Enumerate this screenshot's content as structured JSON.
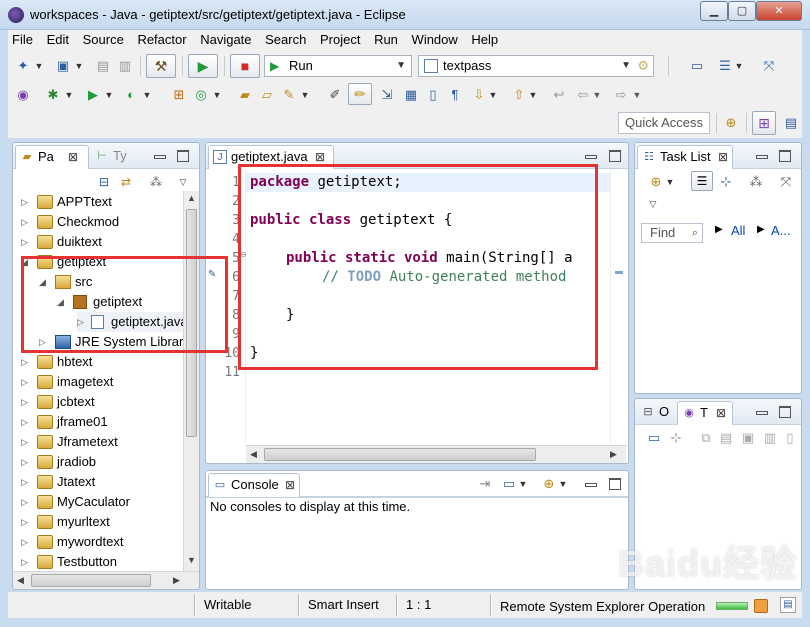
{
  "window": {
    "title": "workspaces - Java - getiptext/src/getiptext/getiptext.java - Eclipse",
    "minimize_glyph": "▁",
    "maximize_glyph": "▢",
    "close_glyph": "✕"
  },
  "menubar": {
    "items": [
      "File",
      "Edit",
      "Source",
      "Refactor",
      "Navigate",
      "Search",
      "Project",
      "Run",
      "Window",
      "Help"
    ]
  },
  "toolbar": {
    "run_config": "Run",
    "launch_target": "textpass",
    "quick_access_placeholder": "Quick Access",
    "icons": [
      "new-icon",
      "new-class-icon",
      "save-icon",
      "save-all-icon",
      "build-icon",
      "run-icon",
      "stop-icon",
      "debug-icon",
      "bug-icon",
      "coverage-icon",
      "external-tools-icon",
      "open-type-icon",
      "open-folder-icon",
      "search-icon",
      "next-annotation-icon",
      "previous-annotation-icon",
      "back-icon",
      "forward-icon",
      "perspective-icon"
    ]
  },
  "package_explorer": {
    "tab_label": "Pa",
    "tab2_label": "Ty",
    "close_glyph": "⊠",
    "tree": [
      {
        "label": "APPTtext",
        "type": "project",
        "level": 0,
        "expanded": false
      },
      {
        "label": "Checkmod",
        "type": "project",
        "level": 0,
        "expanded": false
      },
      {
        "label": "duiktext",
        "type": "project",
        "level": 0,
        "expanded": false
      },
      {
        "label": "getiptext",
        "type": "project",
        "level": 0,
        "expanded": true
      },
      {
        "label": "src",
        "type": "source-folder",
        "level": 1,
        "expanded": true
      },
      {
        "label": "getiptext",
        "type": "package",
        "level": 2,
        "expanded": true
      },
      {
        "label": "getiptext.java",
        "type": "java-file",
        "level": 3,
        "expanded": false
      },
      {
        "label": "JRE System Library",
        "type": "library",
        "level": 1,
        "expanded": false
      },
      {
        "label": "hbtext",
        "type": "project",
        "level": 0,
        "expanded": false
      },
      {
        "label": "imagetext",
        "type": "project",
        "level": 0,
        "expanded": false
      },
      {
        "label": "jcbtext",
        "type": "project",
        "level": 0,
        "expanded": false
      },
      {
        "label": "jframe01",
        "type": "project",
        "level": 0,
        "expanded": false
      },
      {
        "label": "Jframetext",
        "type": "project",
        "level": 0,
        "expanded": false
      },
      {
        "label": "jradiob",
        "type": "project",
        "level": 0,
        "expanded": false
      },
      {
        "label": "Jtatext",
        "type": "project",
        "level": 0,
        "expanded": false
      },
      {
        "label": "MyCaculator",
        "type": "project",
        "level": 0,
        "expanded": false
      },
      {
        "label": "myurltext",
        "type": "project",
        "level": 0,
        "expanded": false
      },
      {
        "label": "mywordtext",
        "type": "project",
        "level": 0,
        "expanded": false
      },
      {
        "label": "Testbutton",
        "type": "project",
        "level": 0,
        "expanded": false
      }
    ]
  },
  "editor": {
    "tab_label": "getiptext.java",
    "line_numbers": [
      "1",
      "2",
      "3",
      "4",
      "5",
      "6",
      "7",
      "8",
      "9",
      "10",
      "11"
    ],
    "code": {
      "l1_kw": "package",
      "l1_rest": " getiptext;",
      "l3_kw": "public class",
      "l3_rest": " getiptext {",
      "l5_kw": "public static void",
      "l5_rest": " main(String[] a",
      "l6_comment_pre": "// ",
      "l6_todo": "TODO",
      "l6_comment_post": " Auto-generated method",
      "l8": "}",
      "l10": "}"
    }
  },
  "task_list": {
    "tab_label": "Task List",
    "find_placeholder": "Find",
    "filter_all": "All",
    "filter_activate": "A..."
  },
  "outline": {
    "tab1_label": "O",
    "tab2_label": "T"
  },
  "console": {
    "tab_label": "Console",
    "message": "No consoles to display at this time."
  },
  "statusbar": {
    "writable": "Writable",
    "insert_mode": "Smart Insert",
    "position": "1 : 1",
    "operation": "Remote System Explorer Operation"
  },
  "watermark": "Baidu经验",
  "colors": {
    "accent_red": "#e53333",
    "keyword": "#7f0055",
    "comment": "#3f7f5f"
  }
}
